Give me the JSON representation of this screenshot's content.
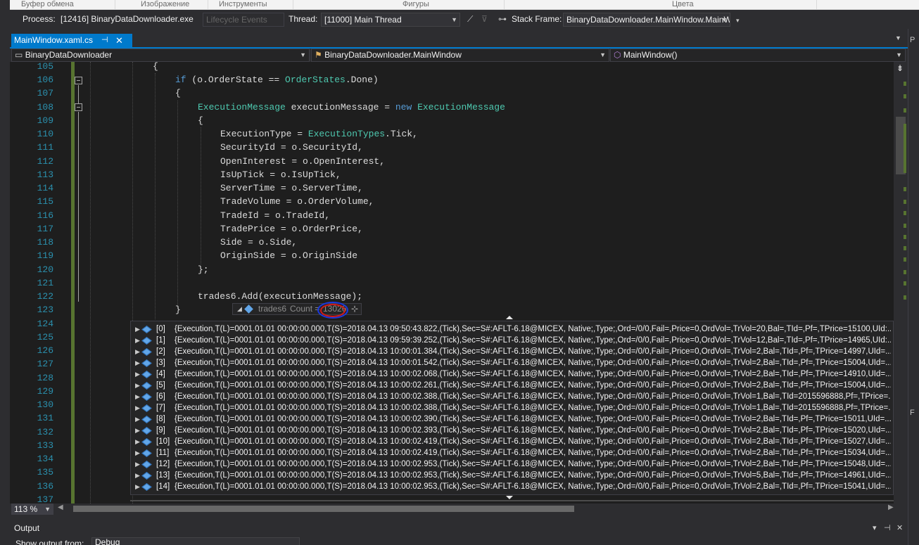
{
  "ribbon": {
    "groups": [
      "Буфер обмена",
      "Изображение",
      "Инструменты",
      "Фигуры",
      "Цвета"
    ]
  },
  "debug_location": {
    "process_label": "Process:",
    "process_value": "[12416] BinaryDataDownloader.exe",
    "lifecycle_label": "Lifecycle Events",
    "thread_label": "Thread:",
    "thread_value": "[11000] Main Thread",
    "stack_frame_label": "Stack Frame:",
    "stack_frame_value": "BinaryDataDownloader.MainWindow.MainWindow"
  },
  "document_tab": {
    "title": "MainWindow.xaml.cs",
    "pin_glyph": "⊣",
    "close_glyph": "✕"
  },
  "navigation": {
    "project": "BinaryDataDownloader",
    "type": "BinaryDataDownloader.MainWindow",
    "member": "MainWindow()"
  },
  "line_numbers": [
    "105",
    "106",
    "107",
    "108",
    "109",
    "110",
    "111",
    "112",
    "113",
    "114",
    "115",
    "116",
    "117",
    "118",
    "119",
    "120",
    "121",
    "122",
    "123",
    "124",
    "125",
    "126",
    "127",
    "128",
    "129",
    "130",
    "131",
    "132",
    "133",
    "134",
    "135",
    "136",
    "137"
  ],
  "code": {
    "l105": "{",
    "l106_kw": "if",
    "l106_rest": " (o.OrderState == ",
    "l106_type": "OrderStates",
    "l106_end": ".Done)",
    "l107": "{",
    "l108_type1": "ExecutionMessage",
    "l108_mid": " executionMessage = ",
    "l108_kw": "new",
    "l108_type2": "ExecutionMessage",
    "l109": "{",
    "l110_a": "ExecutionType = ",
    "l110_type": "ExecutionTypes",
    "l110_b": ".Tick,",
    "l111": "SecurityId = o.SecurityId,",
    "l112": "OpenInterest = o.OpenInterest,",
    "l113": "IsUpTick = o.IsUpTick,",
    "l114": "ServerTime = o.ServerTime,",
    "l115": "TradeVolume = o.OrderVolume,",
    "l116": "TradeId = o.TradeId,",
    "l117": "TradePrice = o.OrderPrice,",
    "l118": "Side = o.Side,",
    "l119": "OriginSide = o.OriginSide",
    "l120": "};",
    "l122": "trades6.Add(executionMessage);",
    "l123": "}"
  },
  "datatip": {
    "var_name": "trades6",
    "count_label": "Count =",
    "count_value": "13026",
    "rows": [
      {
        "index": "[0]",
        "value": "{Execution,T(L)=0001.01.01 00:00:00.000,T(S)=2018.04.13 09:50:43.822,(Tick),Sec=S#:AFLT-6.18@MICEX, Native;,Type;,Ord=/0/0,Fail=,Price=0,OrdVol=,TrVol=20,Bal=,TId=,Pf=,TPrice=15100,UId:..."
      },
      {
        "index": "[1]",
        "value": "{Execution,T(L)=0001.01.01 00:00:00.000,T(S)=2018.04.13 09:59:39.252,(Tick),Sec=S#:AFLT-6.18@MICEX, Native;,Type;,Ord=/0/0,Fail=,Price=0,OrdVol=,TrVol=12,Bal=,TId=,Pf=,TPrice=14965,UId:..."
      },
      {
        "index": "[2]",
        "value": "{Execution,T(L)=0001.01.01 00:00:00.000,T(S)=2018.04.13 10:00:01.384,(Tick),Sec=S#:AFLT-6.18@MICEX, Native;,Type;,Ord=/0/0,Fail=,Price=0,OrdVol=,TrVol=2,Bal=,TId=,Pf=,TPrice=14997,UId=..."
      },
      {
        "index": "[3]",
        "value": "{Execution,T(L)=0001.01.01 00:00:00.000,T(S)=2018.04.13 10:00:01.542,(Tick),Sec=S#:AFLT-6.18@MICEX, Native;,Type;,Ord=/0/0,Fail=,Price=0,OrdVol=,TrVol=2,Bal=,TId=,Pf=,TPrice=15004,UId=..."
      },
      {
        "index": "[4]",
        "value": "{Execution,T(L)=0001.01.01 00:00:00.000,T(S)=2018.04.13 10:00:02.068,(Tick),Sec=S#:AFLT-6.18@MICEX, Native;,Type;,Ord=/0/0,Fail=,Price=0,OrdVol=,TrVol=2,Bal=,TId=,Pf=,TPrice=14910,UId=..."
      },
      {
        "index": "[5]",
        "value": "{Execution,T(L)=0001.01.01 00:00:00.000,T(S)=2018.04.13 10:00:02.261,(Tick),Sec=S#:AFLT-6.18@MICEX, Native;,Type;,Ord=/0/0,Fail=,Price=0,OrdVol=,TrVol=2,Bal=,TId=,Pf=,TPrice=15004,UId=..."
      },
      {
        "index": "[6]",
        "value": "{Execution,T(L)=0001.01.01 00:00:00.000,T(S)=2018.04.13 10:00:02.388,(Tick),Sec=S#:AFLT-6.18@MICEX, Native;,Type;,Ord=/0/0,Fail=,Price=0,OrdVol=,TrVol=1,Bal=,TId=2015596888,Pf=,TPrice=..."
      },
      {
        "index": "[7]",
        "value": "{Execution,T(L)=0001.01.01 00:00:00.000,T(S)=2018.04.13 10:00:02.388,(Tick),Sec=S#:AFLT-6.18@MICEX, Native;,Type;,Ord=/0/0,Fail=,Price=0,OrdVol=,TrVol=1,Bal=,TId=2015596888,Pf=,TPrice=..."
      },
      {
        "index": "[8]",
        "value": "{Execution,T(L)=0001.01.01 00:00:00.000,T(S)=2018.04.13 10:00:02.390,(Tick),Sec=S#:AFLT-6.18@MICEX, Native;,Type;,Ord=/0/0,Fail=,Price=0,OrdVol=,TrVol=2,Bal=,TId=,Pf=,TPrice=15011,UId=..."
      },
      {
        "index": "[9]",
        "value": "{Execution,T(L)=0001.01.01 00:00:00.000,T(S)=2018.04.13 10:00:02.393,(Tick),Sec=S#:AFLT-6.18@MICEX, Native;,Type;,Ord=/0/0,Fail=,Price=0,OrdVol=,TrVol=2,Bal=,TId=,Pf=,TPrice=15020,UId=..."
      },
      {
        "index": "[10]",
        "value": "{Execution,T(L)=0001.01.01 00:00:00.000,T(S)=2018.04.13 10:00:02.419,(Tick),Sec=S#:AFLT-6.18@MICEX, Native;,Type;,Ord=/0/0,Fail=,Price=0,OrdVol=,TrVol=2,Bal=,TId=,Pf=,TPrice=15027,UId=..."
      },
      {
        "index": "[11]",
        "value": "{Execution,T(L)=0001.01.01 00:00:00.000,T(S)=2018.04.13 10:00:02.419,(Tick),Sec=S#:AFLT-6.18@MICEX, Native;,Type;,Ord=/0/0,Fail=,Price=0,OrdVol=,TrVol=2,Bal=,TId=,Pf=,TPrice=15034,UId=..."
      },
      {
        "index": "[12]",
        "value": "{Execution,T(L)=0001.01.01 00:00:00.000,T(S)=2018.04.13 10:00:02.953,(Tick),Sec=S#:AFLT-6.18@MICEX, Native;,Type;,Ord=/0/0,Fail=,Price=0,OrdVol=,TrVol=2,Bal=,TId=,Pf=,TPrice=15048,UId=..."
      },
      {
        "index": "[13]",
        "value": "{Execution,T(L)=0001.01.01 00:00:00.000,T(S)=2018.04.13 10:00:02.953,(Tick),Sec=S#:AFLT-6.18@MICEX, Native;,Type;,Ord=/0/0,Fail=,Price=0,OrdVol=,TrVol=5,Bal=,TId=,Pf=,TPrice=14961,UId=..."
      },
      {
        "index": "[14]",
        "value": "{Execution,T(L)=0001.01.01 00:00:00.000,T(S)=2018.04.13 10:00:02.953,(Tick),Sec=S#:AFLT-6.18@MICEX, Native;,Type;,Ord=/0/0,Fail=,Price=0,OrdVol=,TrVol=2,Bal=,TId=,Pf=,TPrice=15041,UId=..."
      }
    ]
  },
  "editor_status": {
    "zoom": "113 %"
  },
  "output": {
    "title": "Output",
    "show_from_label": "Show output from:",
    "source": "Debug"
  },
  "colors": {
    "accent": "#007acc",
    "keyword": "#569cd6",
    "type": "#4ec9b0",
    "line_number": "#2b91af",
    "changed": "#577430",
    "annotation_red": "#d11a1a",
    "annotation_blue": "#1b38e0"
  }
}
